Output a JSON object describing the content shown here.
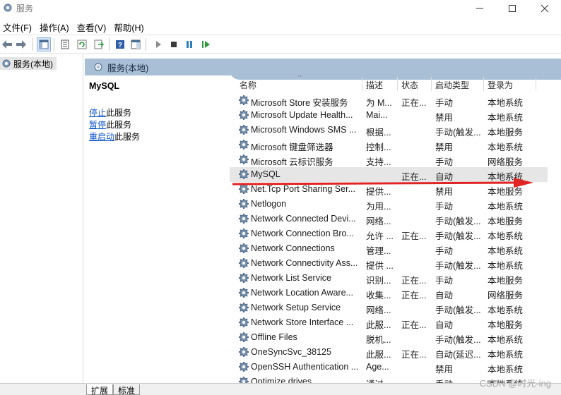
{
  "window": {
    "title": "服务"
  },
  "menu": [
    "文件(F)",
    "操作(A)",
    "查看(V)",
    "帮助(H)"
  ],
  "toolbar": {
    "icons": [
      "back-icon",
      "forward-icon",
      "show-console-tree-icon",
      "properties-icon",
      "refresh-icon",
      "export-list-icon",
      "help-icon",
      "show-hide-action-pane-icon",
      "start-service-icon",
      "stop-service-icon",
      "pause-service-icon",
      "restart-service-icon"
    ]
  },
  "tree": {
    "root_label": "服务(本地)"
  },
  "pane": {
    "header_title": "服务(本地)"
  },
  "description": {
    "service_name": "MySQL",
    "actions": [
      {
        "link": "停止",
        "rest": "此服务"
      },
      {
        "link": "暂停",
        "rest": "此服务"
      },
      {
        "link": "重启动",
        "rest": "此服务"
      }
    ]
  },
  "columns": {
    "name": "名称",
    "desc": "描述",
    "status": "状态",
    "startup": "启动类型",
    "logon": "登录为"
  },
  "services": [
    {
      "name": "Microsoft Store 安装服务",
      "desc": "为 M...",
      "status": "正在...",
      "startup": "手动",
      "logon": "本地系统"
    },
    {
      "name": "Microsoft Update Health...",
      "desc": "Mai...",
      "status": "",
      "startup": "禁用",
      "logon": "本地系统"
    },
    {
      "name": "Microsoft Windows SMS ...",
      "desc": "根据...",
      "status": "",
      "startup": "手动(触发...",
      "logon": "本地服务"
    },
    {
      "name": "Microsoft 键盘筛选器",
      "desc": "控制...",
      "status": "",
      "startup": "禁用",
      "logon": "本地系统"
    },
    {
      "name": "Microsoft 云标识服务",
      "desc": "支持...",
      "status": "",
      "startup": "手动",
      "logon": "网络服务"
    },
    {
      "name": "MySQL",
      "desc": "",
      "status": "正在...",
      "startup": "自动",
      "logon": "本地系统",
      "selected": true
    },
    {
      "name": "Net.Tcp Port Sharing Ser...",
      "desc": "提供...",
      "status": "",
      "startup": "禁用",
      "logon": "本地服务"
    },
    {
      "name": "Netlogon",
      "desc": "为用...",
      "status": "",
      "startup": "手动",
      "logon": "本地系统"
    },
    {
      "name": "Network Connected Devi...",
      "desc": "网络...",
      "status": "",
      "startup": "手动(触发...",
      "logon": "本地服务"
    },
    {
      "name": "Network Connection Bro...",
      "desc": "允许 ...",
      "status": "正在...",
      "startup": "手动(触发...",
      "logon": "本地系统"
    },
    {
      "name": "Network Connections",
      "desc": "管理...",
      "status": "",
      "startup": "手动",
      "logon": "本地系统"
    },
    {
      "name": "Network Connectivity Ass...",
      "desc": "提供 ...",
      "status": "",
      "startup": "手动(触发...",
      "logon": "本地系统"
    },
    {
      "name": "Network List Service",
      "desc": "识别...",
      "status": "正在...",
      "startup": "手动",
      "logon": "本地服务"
    },
    {
      "name": "Network Location Aware...",
      "desc": "收集...",
      "status": "正在...",
      "startup": "自动",
      "logon": "网络服务"
    },
    {
      "name": "Network Setup Service",
      "desc": "网络...",
      "status": "",
      "startup": "手动(触发...",
      "logon": "本地系统"
    },
    {
      "name": "Network Store Interface ...",
      "desc": "此服...",
      "status": "正在...",
      "startup": "自动",
      "logon": "本地服务"
    },
    {
      "name": "Offline Files",
      "desc": "脱机...",
      "status": "",
      "startup": "手动(触发...",
      "logon": "本地系统"
    },
    {
      "name": "OneSyncSvc_38125",
      "desc": "此服...",
      "status": "正在...",
      "startup": "自动(延迟...",
      "logon": "本地系统"
    },
    {
      "name": "OpenSSH Authentication ...",
      "desc": "Age...",
      "status": "",
      "startup": "禁用",
      "logon": "本地系统"
    },
    {
      "name": "Optimize drives",
      "desc": "通过...",
      "status": "",
      "startup": "手动",
      "logon": "本地系统"
    }
  ],
  "tabs": [
    "扩展",
    "标准"
  ],
  "watermark": "CSDN @时光-ing",
  "colors": {
    "header": "#a9bfd6",
    "link": "#1155cc",
    "arrow": "#e02424",
    "selected_row": "#e6e6e6"
  }
}
